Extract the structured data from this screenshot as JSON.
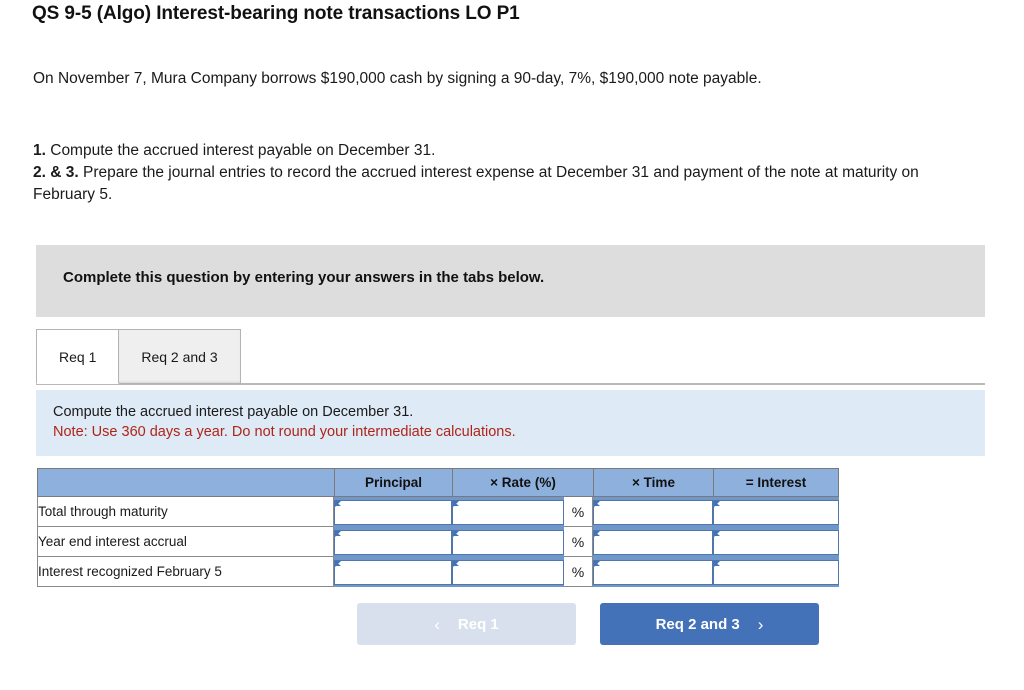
{
  "page_title": "QS 9-5 (Algo) Interest-bearing note transactions LO P1",
  "problem": {
    "scenario": "On November 7, Mura Company borrows $190,000 cash by signing a 90-day, 7%, $190,000 note payable.",
    "requirements": [
      {
        "num": "1.",
        "text": " Compute the accrued interest payable on December 31."
      },
      {
        "num": "2. & 3.",
        "text": " Prepare the journal entries to record the accrued interest expense at December 31 and payment of the note at maturity on February 5."
      }
    ]
  },
  "complete_banner": {
    "text": "Complete this question by entering your answers in the tabs below."
  },
  "tabs": [
    {
      "label": "Req 1",
      "active": true
    },
    {
      "label": "Req 2 and 3",
      "active": false
    }
  ],
  "info_panel": {
    "instruction": "Compute the accrued interest payable on December 31.",
    "note": "Note: Use 360 days a year. Do not round your intermediate calculations.",
    "background_color": "#deeaf6",
    "note_color": "#b02418"
  },
  "answer_table": {
    "headers": [
      "",
      "Principal",
      "× Rate (%)",
      "× Time",
      "= Interest"
    ],
    "header_bg": "#8db0dd",
    "percent_symbol": "%",
    "rows": [
      {
        "label": "Total through maturity",
        "principal": "",
        "rate": "",
        "time": "",
        "interest": ""
      },
      {
        "label": "Year end interest accrual",
        "principal": "",
        "rate": "",
        "time": "",
        "interest": ""
      },
      {
        "label": "Interest recognized February 5",
        "principal": "",
        "rate": "",
        "time": "",
        "interest": ""
      }
    ]
  },
  "nav": {
    "prev_label": "Req 1",
    "next_label": "Req 2 and 3",
    "prev_chevron": "‹",
    "next_chevron": "›",
    "prev_enabled": false,
    "next_enabled": true,
    "prev_color": "#d7e0ec",
    "next_color": "#4472b8"
  }
}
